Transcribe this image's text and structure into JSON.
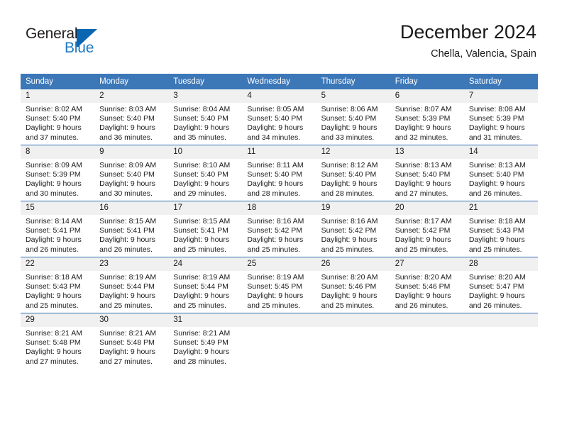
{
  "brand": {
    "name_part1": "General",
    "name_part2": "Blue",
    "accent_color": "#1f78c1",
    "flag_icon": "triangle-flag-icon"
  },
  "header": {
    "month_title": "December 2024",
    "location": "Chella, Valencia, Spain",
    "header_bg_color": "#3c77b8",
    "daynum_bg_color": "#f0f0f0"
  },
  "weekday_headers": [
    "Sunday",
    "Monday",
    "Tuesday",
    "Wednesday",
    "Thursday",
    "Friday",
    "Saturday"
  ],
  "weeks": [
    [
      {
        "day": "1",
        "sunrise": "Sunrise: 8:02 AM",
        "sunset": "Sunset: 5:40 PM",
        "daylight_line1": "Daylight: 9 hours",
        "daylight_line2": "and 37 minutes."
      },
      {
        "day": "2",
        "sunrise": "Sunrise: 8:03 AM",
        "sunset": "Sunset: 5:40 PM",
        "daylight_line1": "Daylight: 9 hours",
        "daylight_line2": "and 36 minutes."
      },
      {
        "day": "3",
        "sunrise": "Sunrise: 8:04 AM",
        "sunset": "Sunset: 5:40 PM",
        "daylight_line1": "Daylight: 9 hours",
        "daylight_line2": "and 35 minutes."
      },
      {
        "day": "4",
        "sunrise": "Sunrise: 8:05 AM",
        "sunset": "Sunset: 5:40 PM",
        "daylight_line1": "Daylight: 9 hours",
        "daylight_line2": "and 34 minutes."
      },
      {
        "day": "5",
        "sunrise": "Sunrise: 8:06 AM",
        "sunset": "Sunset: 5:40 PM",
        "daylight_line1": "Daylight: 9 hours",
        "daylight_line2": "and 33 minutes."
      },
      {
        "day": "6",
        "sunrise": "Sunrise: 8:07 AM",
        "sunset": "Sunset: 5:39 PM",
        "daylight_line1": "Daylight: 9 hours",
        "daylight_line2": "and 32 minutes."
      },
      {
        "day": "7",
        "sunrise": "Sunrise: 8:08 AM",
        "sunset": "Sunset: 5:39 PM",
        "daylight_line1": "Daylight: 9 hours",
        "daylight_line2": "and 31 minutes."
      }
    ],
    [
      {
        "day": "8",
        "sunrise": "Sunrise: 8:09 AM",
        "sunset": "Sunset: 5:39 PM",
        "daylight_line1": "Daylight: 9 hours",
        "daylight_line2": "and 30 minutes."
      },
      {
        "day": "9",
        "sunrise": "Sunrise: 8:09 AM",
        "sunset": "Sunset: 5:40 PM",
        "daylight_line1": "Daylight: 9 hours",
        "daylight_line2": "and 30 minutes."
      },
      {
        "day": "10",
        "sunrise": "Sunrise: 8:10 AM",
        "sunset": "Sunset: 5:40 PM",
        "daylight_line1": "Daylight: 9 hours",
        "daylight_line2": "and 29 minutes."
      },
      {
        "day": "11",
        "sunrise": "Sunrise: 8:11 AM",
        "sunset": "Sunset: 5:40 PM",
        "daylight_line1": "Daylight: 9 hours",
        "daylight_line2": "and 28 minutes."
      },
      {
        "day": "12",
        "sunrise": "Sunrise: 8:12 AM",
        "sunset": "Sunset: 5:40 PM",
        "daylight_line1": "Daylight: 9 hours",
        "daylight_line2": "and 28 minutes."
      },
      {
        "day": "13",
        "sunrise": "Sunrise: 8:13 AM",
        "sunset": "Sunset: 5:40 PM",
        "daylight_line1": "Daylight: 9 hours",
        "daylight_line2": "and 27 minutes."
      },
      {
        "day": "14",
        "sunrise": "Sunrise: 8:13 AM",
        "sunset": "Sunset: 5:40 PM",
        "daylight_line1": "Daylight: 9 hours",
        "daylight_line2": "and 26 minutes."
      }
    ],
    [
      {
        "day": "15",
        "sunrise": "Sunrise: 8:14 AM",
        "sunset": "Sunset: 5:41 PM",
        "daylight_line1": "Daylight: 9 hours",
        "daylight_line2": "and 26 minutes."
      },
      {
        "day": "16",
        "sunrise": "Sunrise: 8:15 AM",
        "sunset": "Sunset: 5:41 PM",
        "daylight_line1": "Daylight: 9 hours",
        "daylight_line2": "and 26 minutes."
      },
      {
        "day": "17",
        "sunrise": "Sunrise: 8:15 AM",
        "sunset": "Sunset: 5:41 PM",
        "daylight_line1": "Daylight: 9 hours",
        "daylight_line2": "and 25 minutes."
      },
      {
        "day": "18",
        "sunrise": "Sunrise: 8:16 AM",
        "sunset": "Sunset: 5:42 PM",
        "daylight_line1": "Daylight: 9 hours",
        "daylight_line2": "and 25 minutes."
      },
      {
        "day": "19",
        "sunrise": "Sunrise: 8:16 AM",
        "sunset": "Sunset: 5:42 PM",
        "daylight_line1": "Daylight: 9 hours",
        "daylight_line2": "and 25 minutes."
      },
      {
        "day": "20",
        "sunrise": "Sunrise: 8:17 AM",
        "sunset": "Sunset: 5:42 PM",
        "daylight_line1": "Daylight: 9 hours",
        "daylight_line2": "and 25 minutes."
      },
      {
        "day": "21",
        "sunrise": "Sunrise: 8:18 AM",
        "sunset": "Sunset: 5:43 PM",
        "daylight_line1": "Daylight: 9 hours",
        "daylight_line2": "and 25 minutes."
      }
    ],
    [
      {
        "day": "22",
        "sunrise": "Sunrise: 8:18 AM",
        "sunset": "Sunset: 5:43 PM",
        "daylight_line1": "Daylight: 9 hours",
        "daylight_line2": "and 25 minutes."
      },
      {
        "day": "23",
        "sunrise": "Sunrise: 8:19 AM",
        "sunset": "Sunset: 5:44 PM",
        "daylight_line1": "Daylight: 9 hours",
        "daylight_line2": "and 25 minutes."
      },
      {
        "day": "24",
        "sunrise": "Sunrise: 8:19 AM",
        "sunset": "Sunset: 5:44 PM",
        "daylight_line1": "Daylight: 9 hours",
        "daylight_line2": "and 25 minutes."
      },
      {
        "day": "25",
        "sunrise": "Sunrise: 8:19 AM",
        "sunset": "Sunset: 5:45 PM",
        "daylight_line1": "Daylight: 9 hours",
        "daylight_line2": "and 25 minutes."
      },
      {
        "day": "26",
        "sunrise": "Sunrise: 8:20 AM",
        "sunset": "Sunset: 5:46 PM",
        "daylight_line1": "Daylight: 9 hours",
        "daylight_line2": "and 25 minutes."
      },
      {
        "day": "27",
        "sunrise": "Sunrise: 8:20 AM",
        "sunset": "Sunset: 5:46 PM",
        "daylight_line1": "Daylight: 9 hours",
        "daylight_line2": "and 26 minutes."
      },
      {
        "day": "28",
        "sunrise": "Sunrise: 8:20 AM",
        "sunset": "Sunset: 5:47 PM",
        "daylight_line1": "Daylight: 9 hours",
        "daylight_line2": "and 26 minutes."
      }
    ],
    [
      {
        "day": "29",
        "sunrise": "Sunrise: 8:21 AM",
        "sunset": "Sunset: 5:48 PM",
        "daylight_line1": "Daylight: 9 hours",
        "daylight_line2": "and 27 minutes."
      },
      {
        "day": "30",
        "sunrise": "Sunrise: 8:21 AM",
        "sunset": "Sunset: 5:48 PM",
        "daylight_line1": "Daylight: 9 hours",
        "daylight_line2": "and 27 minutes."
      },
      {
        "day": "31",
        "sunrise": "Sunrise: 8:21 AM",
        "sunset": "Sunset: 5:49 PM",
        "daylight_line1": "Daylight: 9 hours",
        "daylight_line2": "and 28 minutes."
      },
      {
        "day": "",
        "sunrise": "",
        "sunset": "",
        "daylight_line1": "",
        "daylight_line2": ""
      },
      {
        "day": "",
        "sunrise": "",
        "sunset": "",
        "daylight_line1": "",
        "daylight_line2": ""
      },
      {
        "day": "",
        "sunrise": "",
        "sunset": "",
        "daylight_line1": "",
        "daylight_line2": ""
      },
      {
        "day": "",
        "sunrise": "",
        "sunset": "",
        "daylight_line1": "",
        "daylight_line2": ""
      }
    ]
  ]
}
